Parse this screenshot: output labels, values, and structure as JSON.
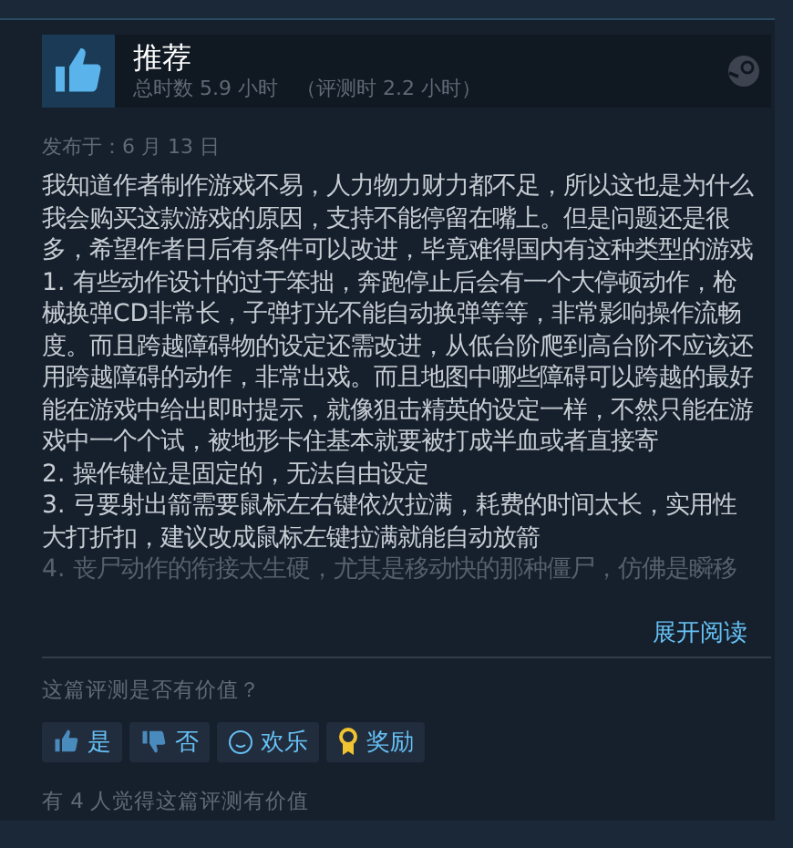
{
  "review": {
    "verdict": "推荐",
    "playtime": "总时数 5.9 小时",
    "playtime_at_review": "（评测时 2.2 小时）",
    "posted": "发布于：6 月 13 日",
    "paragraphs": [
      {
        "text": "我知道作者制作游戏不易，人力物力财力都不足，所以这也是为什么我会购买这款游戏的原因，支持不能停留在嘴上。但是问题还是很多，希望作者日后有条件可以改进，毕竟难得国内有这种类型的游戏",
        "faded": false
      },
      {
        "text": "1. 有些动作设计的过于笨拙，奔跑停止后会有一个大停顿动作，枪械换弹CD非常长，子弹打光不能自动换弹等等，非常影响操作流畅度。而且跨越障碍物的设定还需改进，从低台阶爬到高台阶不应该还用跨越障碍的动作，非常出戏。而且地图中哪些障碍可以跨越的最好能在游戏中给出即时提示，就像狙击精英的设定一样，不然只能在游戏中一个个试，被地形卡住基本就要被打成半血或者直接寄",
        "faded": false
      },
      {
        "text": "2. 操作键位是固定的，无法自由设定",
        "faded": false
      },
      {
        "text": "3. 弓要射出箭需要鼠标左右键依次拉满，耗费的时间太长，实用性大打折扣，建议改成鼠标左键拉满就能自动放箭",
        "faded": false
      },
      {
        "text": "4. 丧尸动作的衔接太生硬，尤其是移动快的那种僵尸，仿佛是瞬移",
        "faded": true
      }
    ],
    "expand": "展开阅读",
    "question": "这篇评测是否有价值？",
    "buttons": [
      {
        "kind": "yes",
        "label": "是"
      },
      {
        "kind": "no",
        "label": "否"
      },
      {
        "kind": "funny",
        "label": "欢乐"
      },
      {
        "kind": "award",
        "label": "奖励"
      }
    ],
    "helpful": "有 4 人觉得这篇评测有价值"
  }
}
